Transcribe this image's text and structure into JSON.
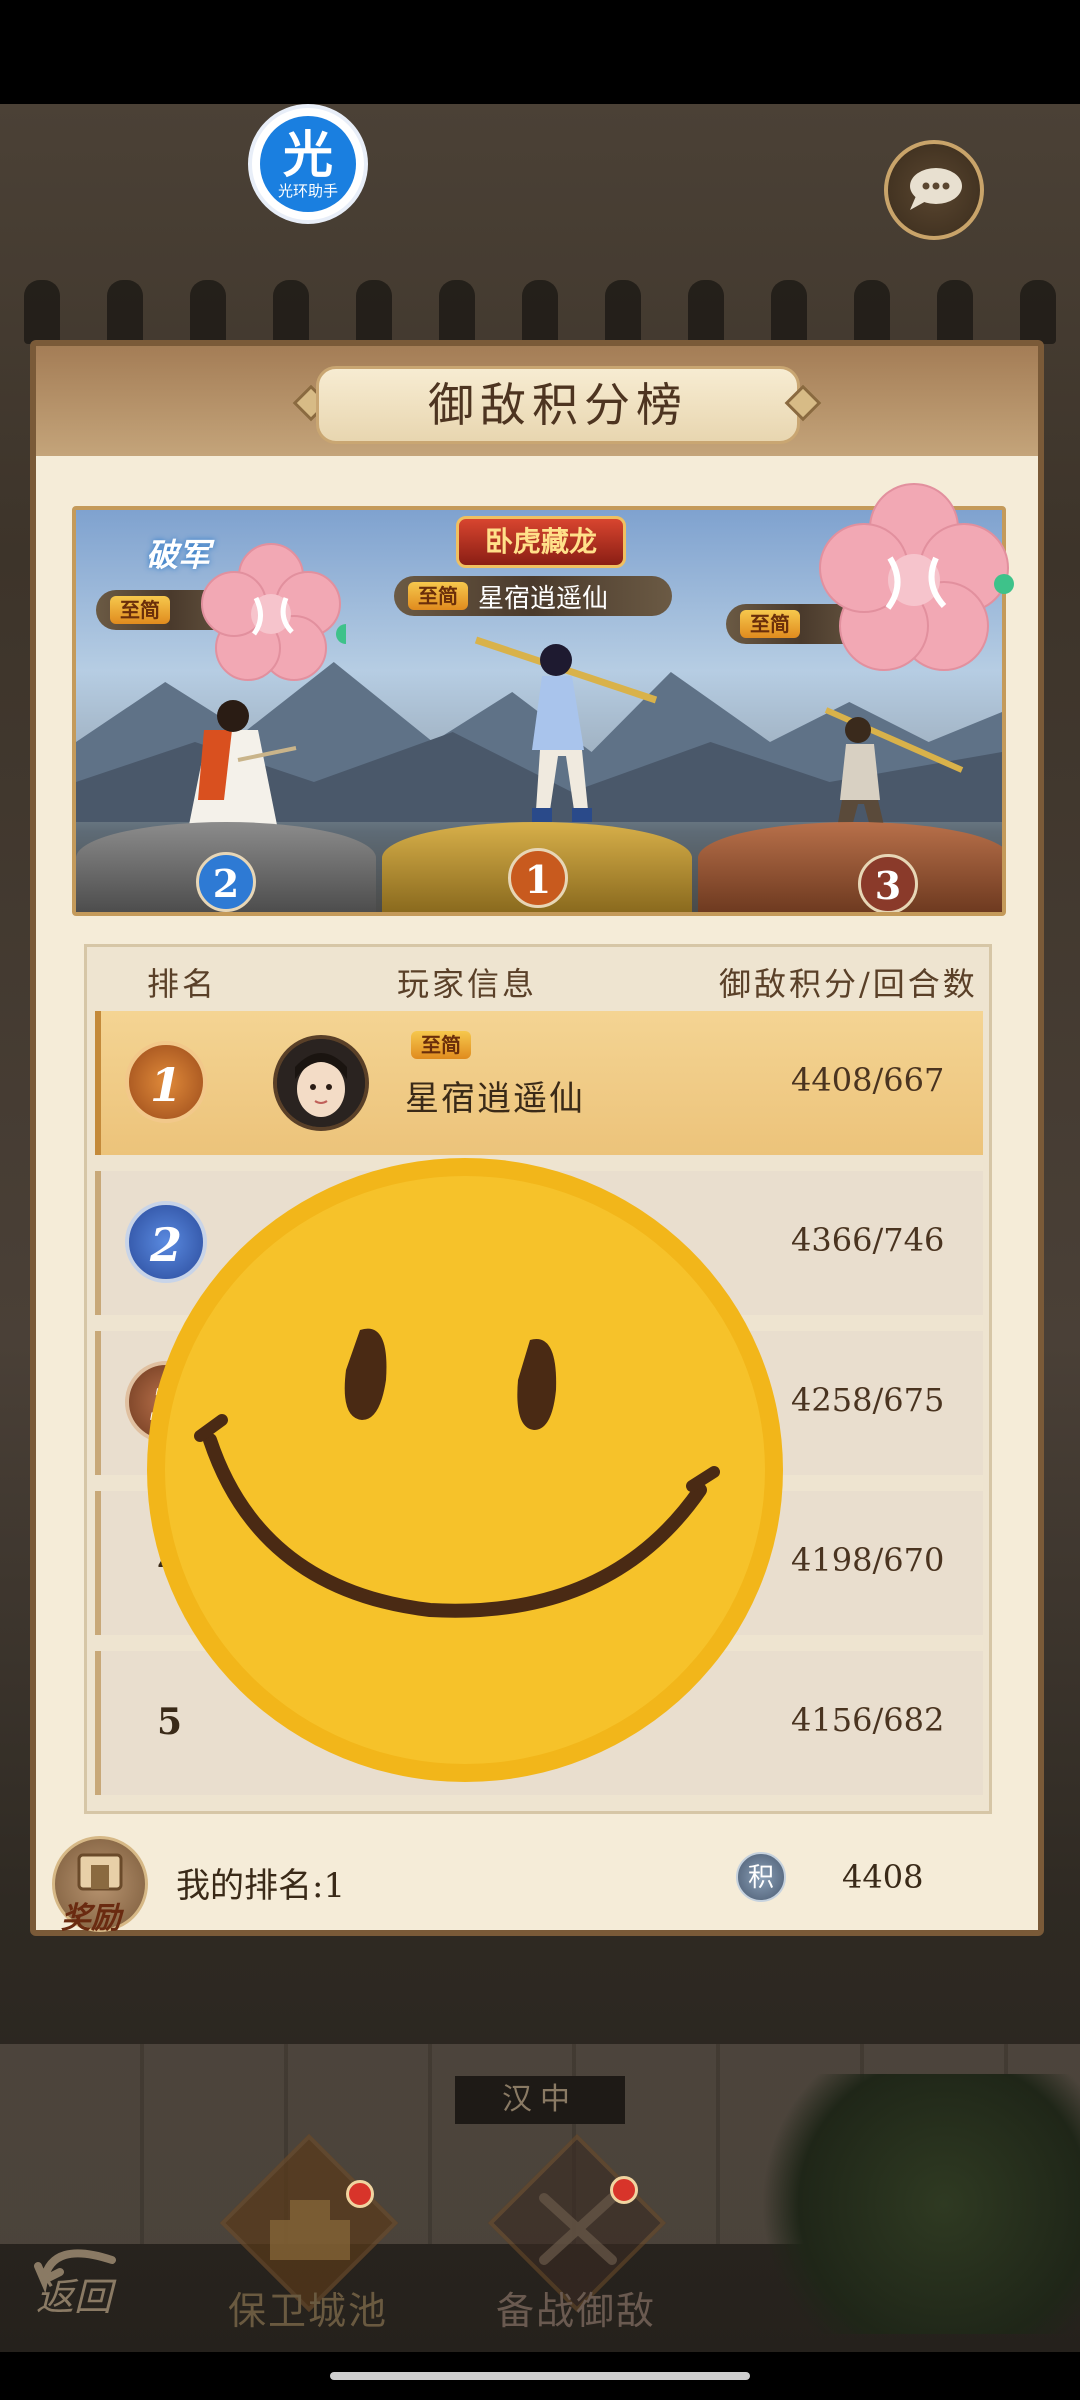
{
  "helper": {
    "big": "光",
    "small": "光环助手"
  },
  "panel": {
    "title": "御敌积分榜"
  },
  "banner": {
    "event_badge": "卧虎藏龙",
    "corner_tag": "破军",
    "center_tag": "至简",
    "center_name": "星宿逍遥仙",
    "left_tag": "至简",
    "right_tag": "至简",
    "podium_left": "2",
    "podium_center": "1",
    "podium_right": "3"
  },
  "table": {
    "headers": {
      "rank": "排名",
      "player": "玩家信息",
      "score": "御敌积分/回合数"
    },
    "rows": [
      {
        "rank": "1",
        "tag": "至简",
        "name": "星宿逍遥仙",
        "score": "4408/667"
      },
      {
        "rank": "2",
        "score": "4366/746"
      },
      {
        "rank": "3",
        "score": "4258/675"
      },
      {
        "rank": "4",
        "score": "4198/670"
      },
      {
        "rank": "5",
        "score": "4156/682"
      }
    ]
  },
  "footer": {
    "reward_label": "奖励",
    "my_rank": "我的排名:1",
    "score_icon": "积",
    "my_score": "4408"
  },
  "scene": {
    "city_label": "汉中"
  },
  "nav": {
    "back": "返回",
    "defend": "保卫城池",
    "prepare": "备战御敌"
  },
  "colors": {
    "panel_bg": "#f5ecd8",
    "first_row": "#f4d493",
    "accent_gold": "#c49a5a",
    "red_dot": "#d8342a"
  },
  "icons": [
    "helper-icon",
    "chat-icon",
    "trophy-icon",
    "score-icon",
    "back-arrow-icon",
    "castle-icon",
    "crossed-swords-icon"
  ]
}
